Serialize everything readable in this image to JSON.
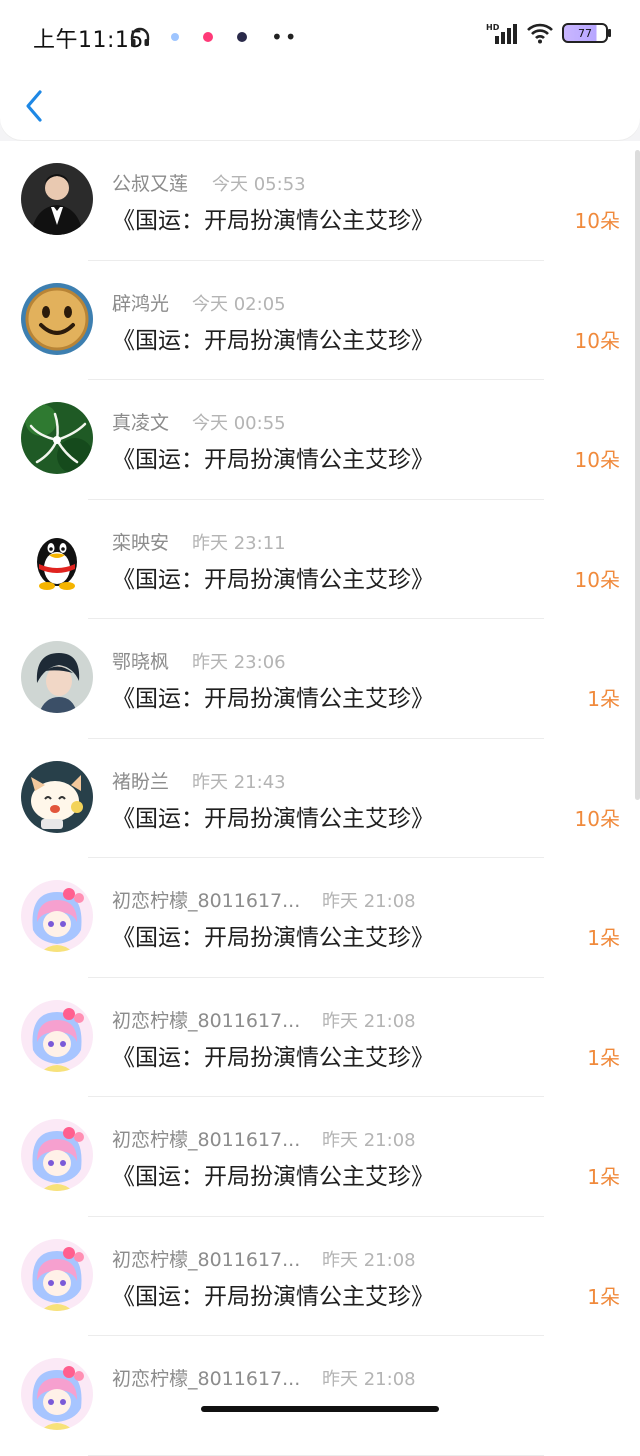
{
  "status_bar": {
    "time": "上午11:15",
    "network_label": "HD",
    "battery": "77"
  },
  "rows": [
    {
      "name": "公叔又莲",
      "time": "今天 05:53",
      "title": "《国运：开局扮演情公主艾珍》",
      "amount": "10朵",
      "avatar": "man-suit"
    },
    {
      "name": "辟鸿光",
      "time": "今天 02:05",
      "title": "《国运：开局扮演情公主艾珍》",
      "amount": "10朵",
      "avatar": "smiley"
    },
    {
      "name": "真凌文",
      "time": "今天 00:55",
      "title": "《国运：开局扮演情公主艾珍》",
      "amount": "10朵",
      "avatar": "flower"
    },
    {
      "name": "栾映安",
      "time": "昨天 23:11",
      "title": "《国运：开局扮演情公主艾珍》",
      "amount": "10朵",
      "avatar": "penguin"
    },
    {
      "name": "鄂晓枫",
      "time": "昨天 23:06",
      "title": "《国运：开局扮演情公主艾珍》",
      "amount": "1朵",
      "avatar": "girl-photo"
    },
    {
      "name": "褚盼兰",
      "time": "昨天 21:43",
      "title": "《国运：开局扮演情公主艾珍》",
      "amount": "10朵",
      "avatar": "cartoon-cat"
    },
    {
      "name": "初恋柠檬_8011617...",
      "time": "昨天 21:08",
      "title": "《国运：开局扮演情公主艾珍》",
      "amount": "1朵",
      "avatar": "anime-girl"
    },
    {
      "name": "初恋柠檬_8011617...",
      "time": "昨天 21:08",
      "title": "《国运：开局扮演情公主艾珍》",
      "amount": "1朵",
      "avatar": "anime-girl"
    },
    {
      "name": "初恋柠檬_8011617...",
      "time": "昨天 21:08",
      "title": "《国运：开局扮演情公主艾珍》",
      "amount": "1朵",
      "avatar": "anime-girl"
    },
    {
      "name": "初恋柠檬_8011617...",
      "time": "昨天 21:08",
      "title": "《国运：开局扮演情公主艾珍》",
      "amount": "1朵",
      "avatar": "anime-girl"
    },
    {
      "name": "初恋柠檬_8011617...",
      "time": "昨天 21:08",
      "title": "",
      "amount": "",
      "avatar": "anime-girl"
    }
  ],
  "colors": {
    "accent": "#1e88e5",
    "amount": "#f08a3c"
  }
}
